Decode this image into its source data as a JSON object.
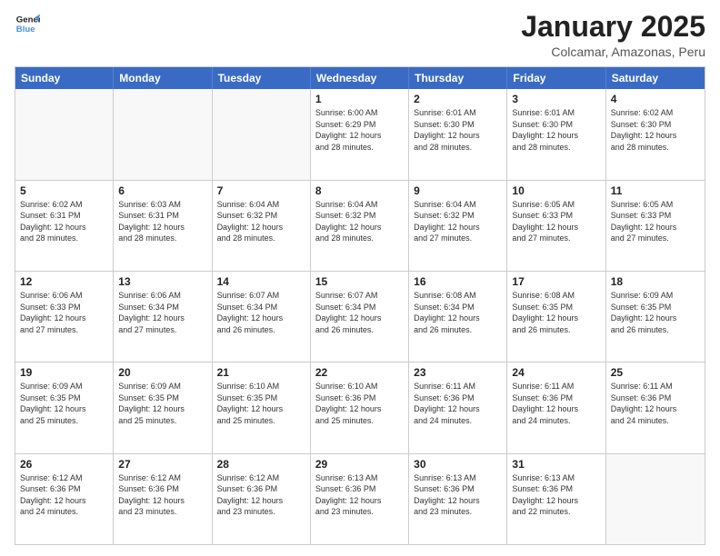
{
  "logo": {
    "line1": "General",
    "line2": "Blue"
  },
  "title": "January 2025",
  "subtitle": "Colcamar, Amazonas, Peru",
  "weekdays": [
    "Sunday",
    "Monday",
    "Tuesday",
    "Wednesday",
    "Thursday",
    "Friday",
    "Saturday"
  ],
  "weeks": [
    [
      {
        "day": "",
        "text": "",
        "empty": true
      },
      {
        "day": "",
        "text": "",
        "empty": true
      },
      {
        "day": "",
        "text": "",
        "empty": true
      },
      {
        "day": "1",
        "text": "Sunrise: 6:00 AM\nSunset: 6:29 PM\nDaylight: 12 hours\nand 28 minutes.",
        "empty": false
      },
      {
        "day": "2",
        "text": "Sunrise: 6:01 AM\nSunset: 6:30 PM\nDaylight: 12 hours\nand 28 minutes.",
        "empty": false
      },
      {
        "day": "3",
        "text": "Sunrise: 6:01 AM\nSunset: 6:30 PM\nDaylight: 12 hours\nand 28 minutes.",
        "empty": false
      },
      {
        "day": "4",
        "text": "Sunrise: 6:02 AM\nSunset: 6:30 PM\nDaylight: 12 hours\nand 28 minutes.",
        "empty": false
      }
    ],
    [
      {
        "day": "5",
        "text": "Sunrise: 6:02 AM\nSunset: 6:31 PM\nDaylight: 12 hours\nand 28 minutes.",
        "empty": false
      },
      {
        "day": "6",
        "text": "Sunrise: 6:03 AM\nSunset: 6:31 PM\nDaylight: 12 hours\nand 28 minutes.",
        "empty": false
      },
      {
        "day": "7",
        "text": "Sunrise: 6:04 AM\nSunset: 6:32 PM\nDaylight: 12 hours\nand 28 minutes.",
        "empty": false
      },
      {
        "day": "8",
        "text": "Sunrise: 6:04 AM\nSunset: 6:32 PM\nDaylight: 12 hours\nand 28 minutes.",
        "empty": false
      },
      {
        "day": "9",
        "text": "Sunrise: 6:04 AM\nSunset: 6:32 PM\nDaylight: 12 hours\nand 27 minutes.",
        "empty": false
      },
      {
        "day": "10",
        "text": "Sunrise: 6:05 AM\nSunset: 6:33 PM\nDaylight: 12 hours\nand 27 minutes.",
        "empty": false
      },
      {
        "day": "11",
        "text": "Sunrise: 6:05 AM\nSunset: 6:33 PM\nDaylight: 12 hours\nand 27 minutes.",
        "empty": false
      }
    ],
    [
      {
        "day": "12",
        "text": "Sunrise: 6:06 AM\nSunset: 6:33 PM\nDaylight: 12 hours\nand 27 minutes.",
        "empty": false
      },
      {
        "day": "13",
        "text": "Sunrise: 6:06 AM\nSunset: 6:34 PM\nDaylight: 12 hours\nand 27 minutes.",
        "empty": false
      },
      {
        "day": "14",
        "text": "Sunrise: 6:07 AM\nSunset: 6:34 PM\nDaylight: 12 hours\nand 26 minutes.",
        "empty": false
      },
      {
        "day": "15",
        "text": "Sunrise: 6:07 AM\nSunset: 6:34 PM\nDaylight: 12 hours\nand 26 minutes.",
        "empty": false
      },
      {
        "day": "16",
        "text": "Sunrise: 6:08 AM\nSunset: 6:34 PM\nDaylight: 12 hours\nand 26 minutes.",
        "empty": false
      },
      {
        "day": "17",
        "text": "Sunrise: 6:08 AM\nSunset: 6:35 PM\nDaylight: 12 hours\nand 26 minutes.",
        "empty": false
      },
      {
        "day": "18",
        "text": "Sunrise: 6:09 AM\nSunset: 6:35 PM\nDaylight: 12 hours\nand 26 minutes.",
        "empty": false
      }
    ],
    [
      {
        "day": "19",
        "text": "Sunrise: 6:09 AM\nSunset: 6:35 PM\nDaylight: 12 hours\nand 25 minutes.",
        "empty": false
      },
      {
        "day": "20",
        "text": "Sunrise: 6:09 AM\nSunset: 6:35 PM\nDaylight: 12 hours\nand 25 minutes.",
        "empty": false
      },
      {
        "day": "21",
        "text": "Sunrise: 6:10 AM\nSunset: 6:35 PM\nDaylight: 12 hours\nand 25 minutes.",
        "empty": false
      },
      {
        "day": "22",
        "text": "Sunrise: 6:10 AM\nSunset: 6:36 PM\nDaylight: 12 hours\nand 25 minutes.",
        "empty": false
      },
      {
        "day": "23",
        "text": "Sunrise: 6:11 AM\nSunset: 6:36 PM\nDaylight: 12 hours\nand 24 minutes.",
        "empty": false
      },
      {
        "day": "24",
        "text": "Sunrise: 6:11 AM\nSunset: 6:36 PM\nDaylight: 12 hours\nand 24 minutes.",
        "empty": false
      },
      {
        "day": "25",
        "text": "Sunrise: 6:11 AM\nSunset: 6:36 PM\nDaylight: 12 hours\nand 24 minutes.",
        "empty": false
      }
    ],
    [
      {
        "day": "26",
        "text": "Sunrise: 6:12 AM\nSunset: 6:36 PM\nDaylight: 12 hours\nand 24 minutes.",
        "empty": false
      },
      {
        "day": "27",
        "text": "Sunrise: 6:12 AM\nSunset: 6:36 PM\nDaylight: 12 hours\nand 23 minutes.",
        "empty": false
      },
      {
        "day": "28",
        "text": "Sunrise: 6:12 AM\nSunset: 6:36 PM\nDaylight: 12 hours\nand 23 minutes.",
        "empty": false
      },
      {
        "day": "29",
        "text": "Sunrise: 6:13 AM\nSunset: 6:36 PM\nDaylight: 12 hours\nand 23 minutes.",
        "empty": false
      },
      {
        "day": "30",
        "text": "Sunrise: 6:13 AM\nSunset: 6:36 PM\nDaylight: 12 hours\nand 23 minutes.",
        "empty": false
      },
      {
        "day": "31",
        "text": "Sunrise: 6:13 AM\nSunset: 6:36 PM\nDaylight: 12 hours\nand 22 minutes.",
        "empty": false
      },
      {
        "day": "",
        "text": "",
        "empty": true
      }
    ]
  ]
}
